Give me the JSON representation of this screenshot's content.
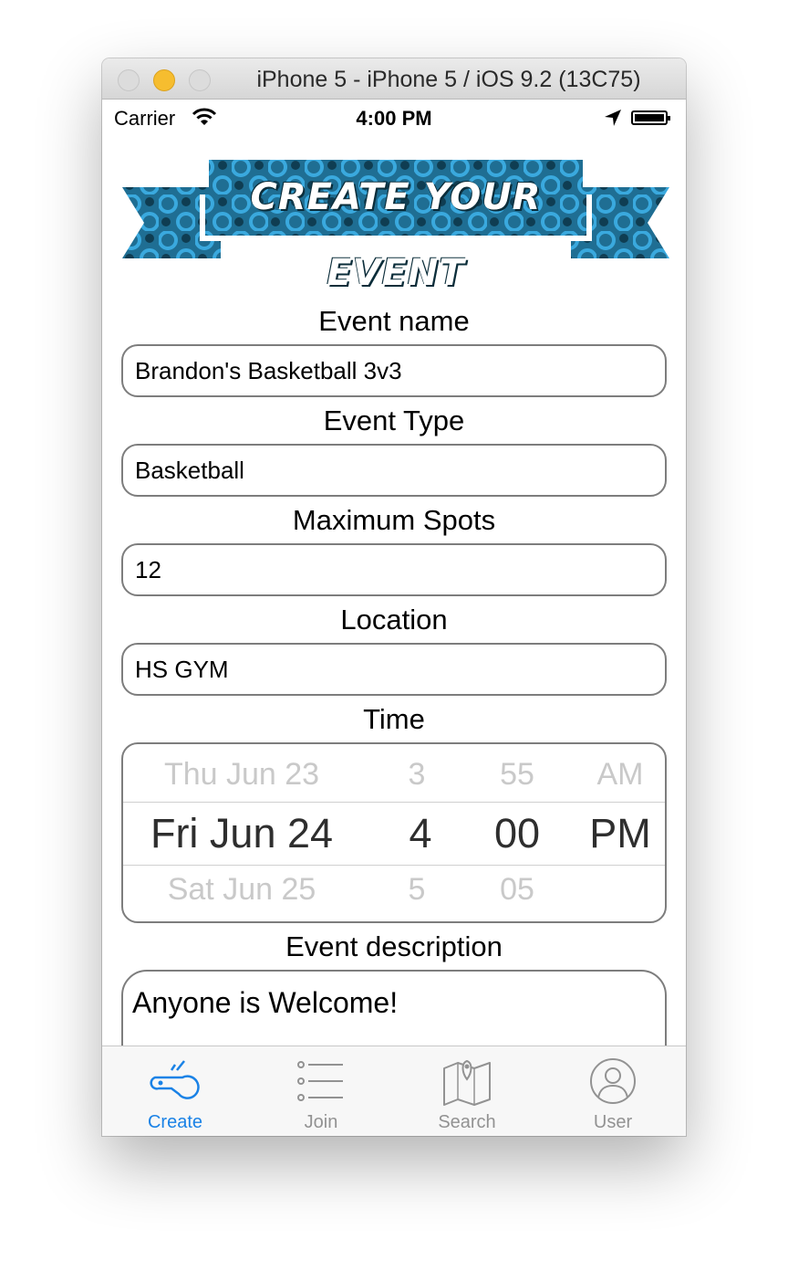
{
  "window": {
    "title": "iPhone 5 - iPhone 5 / iOS 9.2 (13C75)"
  },
  "statusbar": {
    "carrier": "Carrier",
    "time": "4:00 PM"
  },
  "banner": {
    "text": "CREATE YOUR EVENT"
  },
  "form": {
    "event_name_label": "Event name",
    "event_name_value": "Brandon's Basketball 3v3",
    "event_type_label": "Event Type",
    "event_type_value": "Basketball",
    "max_spots_label": "Maximum Spots",
    "max_spots_value": "12",
    "location_label": "Location",
    "location_value": "HS GYM",
    "time_label": "Time",
    "description_label": "Event description",
    "description_value": "Anyone is Welcome!"
  },
  "picker": {
    "date": {
      "prev": "Thu Jun 23",
      "selected": "Fri Jun 24",
      "next": "Sat Jun 25"
    },
    "hour": {
      "prev": "3",
      "selected": "4",
      "next": "5"
    },
    "minute": {
      "prev": "55",
      "selected": "00",
      "next": "05"
    },
    "ampm": {
      "prev": "AM",
      "selected": "PM",
      "next": ""
    }
  },
  "tabbar": {
    "active_color": "#1a82e6",
    "inactive_color": "#929292",
    "tabs": [
      {
        "label": "Create",
        "icon": "whistle-icon"
      },
      {
        "label": "Join",
        "icon": "list-icon"
      },
      {
        "label": "Search",
        "icon": "map-icon"
      },
      {
        "label": "User",
        "icon": "user-icon"
      }
    ]
  }
}
